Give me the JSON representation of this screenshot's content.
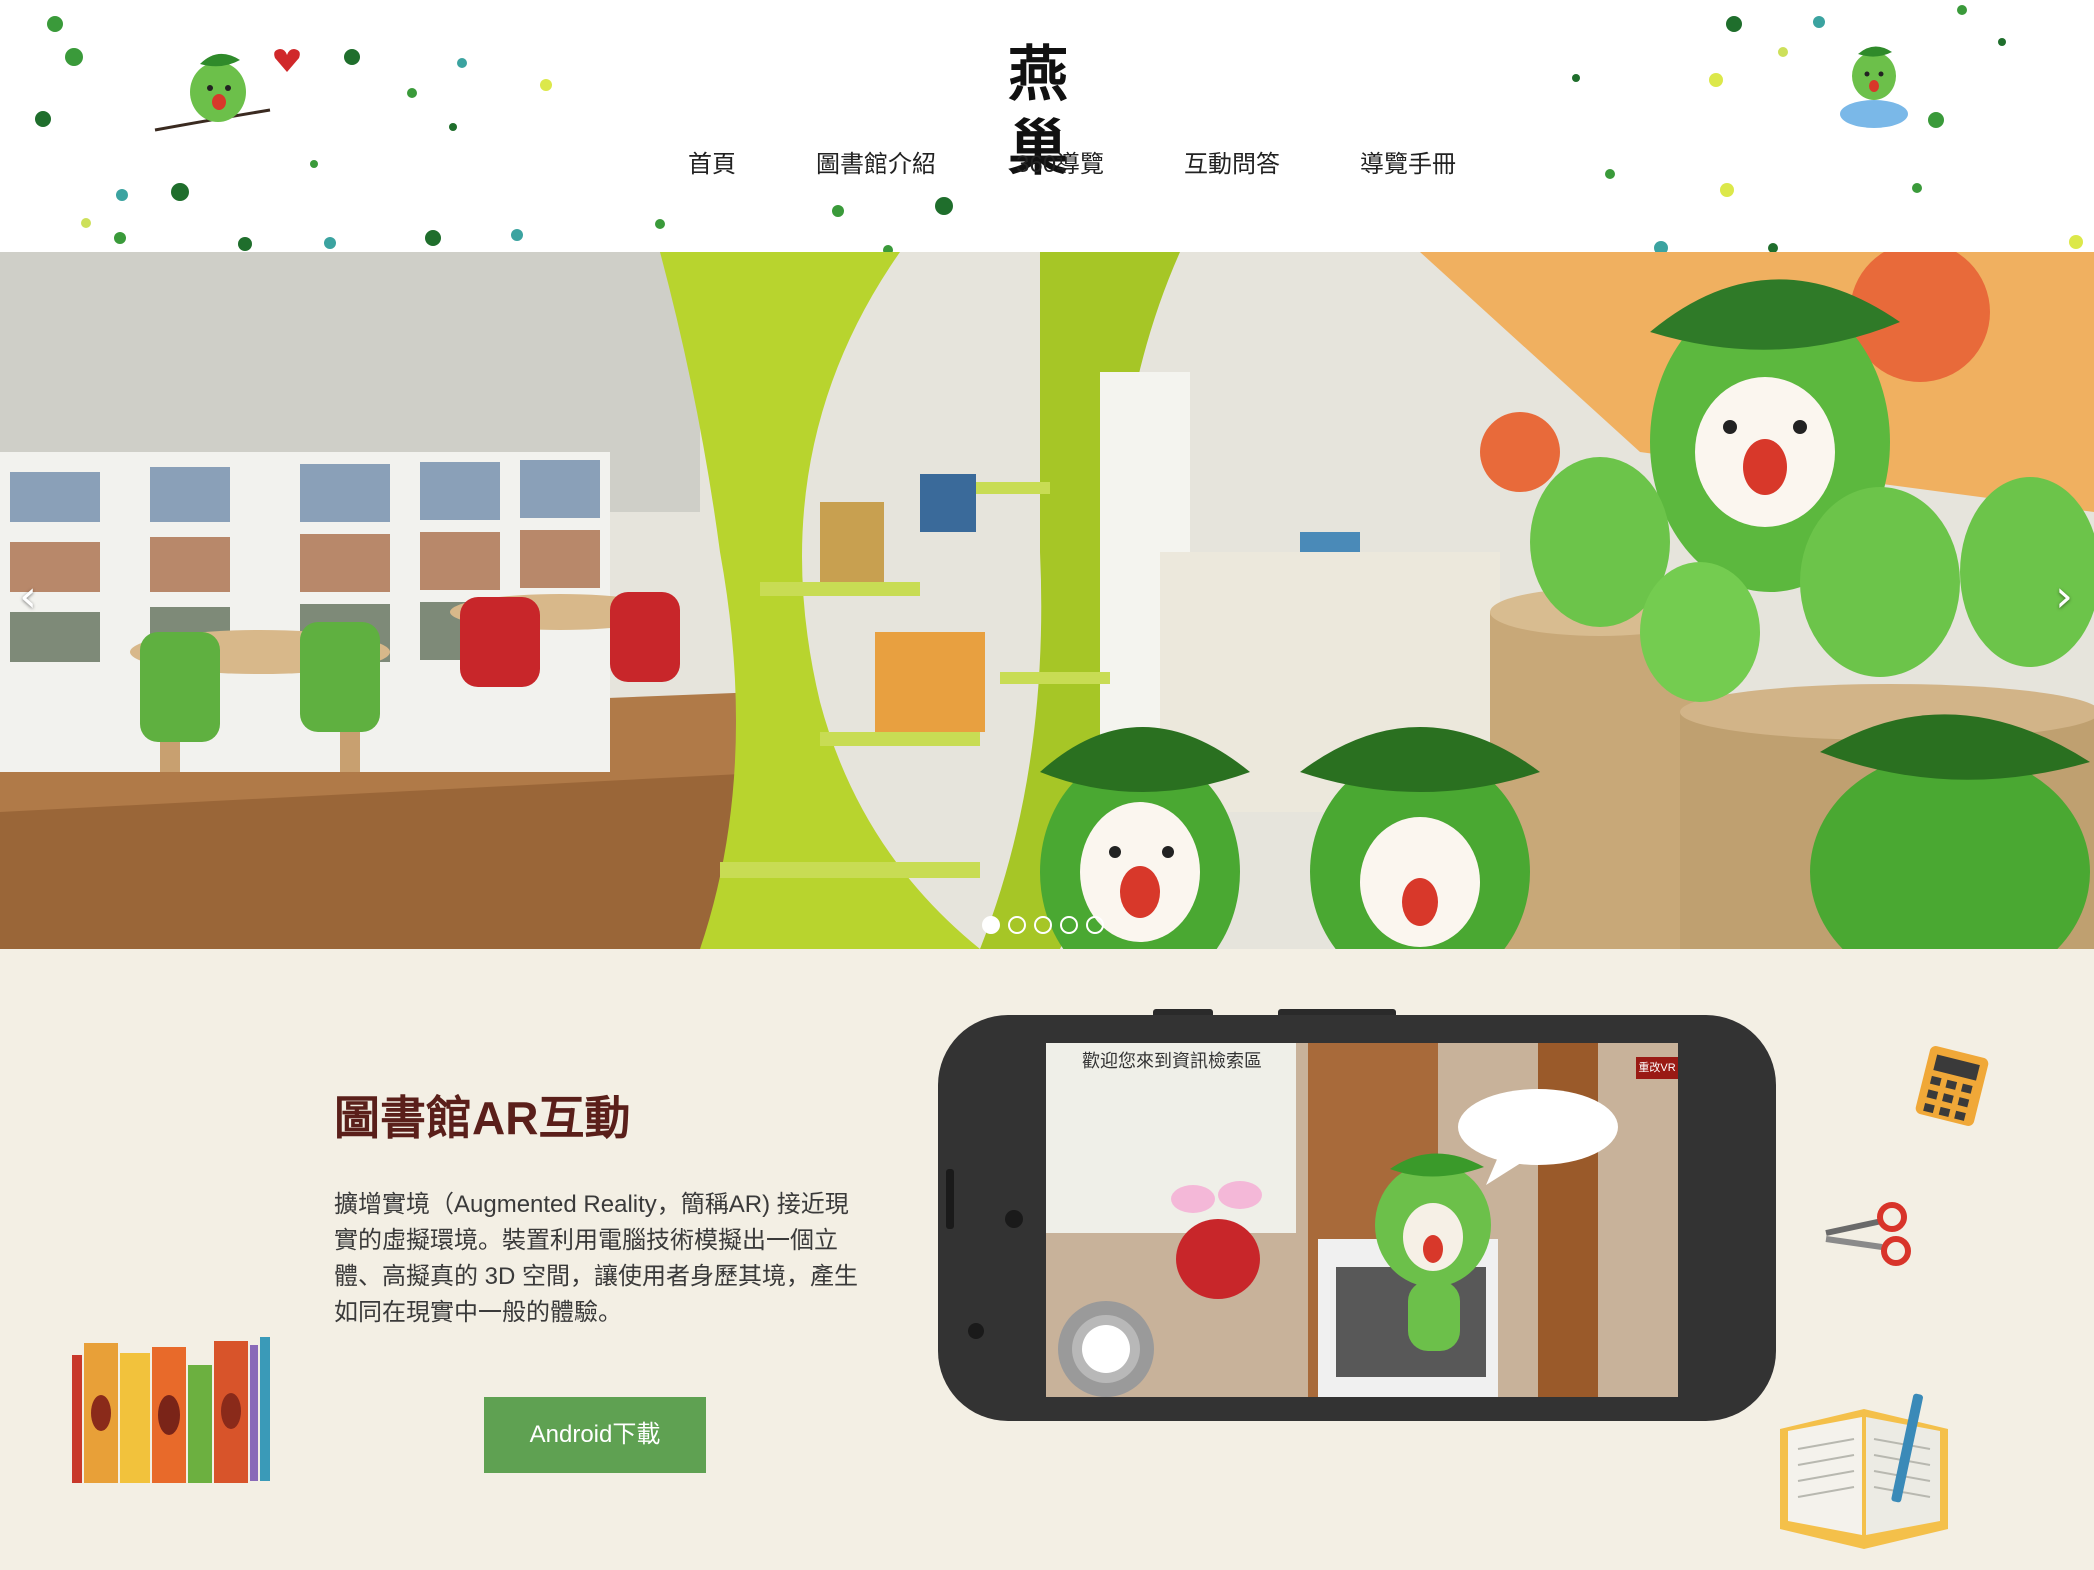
{
  "header": {
    "logo_text": "燕巢",
    "nav": [
      {
        "label": "首頁"
      },
      {
        "label": "圖書館介紹"
      },
      {
        "label": "360導覽"
      },
      {
        "label": "互動問答"
      },
      {
        "label": "導覽手冊"
      }
    ]
  },
  "carousel": {
    "prev_glyph": "‹",
    "next_glyph": "›",
    "slide_count": 5,
    "active_index": 0
  },
  "ar": {
    "title": "圖書館AR互動",
    "description": "擴增實境（Augmented Reality，簡稱AR) 接近現實的虛擬環境。裝置利用電腦技術模擬出一個立體、高擬真的 3D 空間，讓使用者身歷其境，產生如同在現實中一般的體驗。",
    "download_label": "Android下載",
    "phone_screen": {
      "caption": "歡迎您來到資訊檢索區",
      "corner_label": "重改VR"
    }
  },
  "colors": {
    "accent_green": "#5fa152",
    "title_brown": "#5a1f1a",
    "section_bg": "#f3efe4"
  },
  "icons": [
    "heart-icon",
    "mascot-icon",
    "calculator-icon",
    "scissors-icon",
    "books-icon",
    "open-book-icon"
  ]
}
